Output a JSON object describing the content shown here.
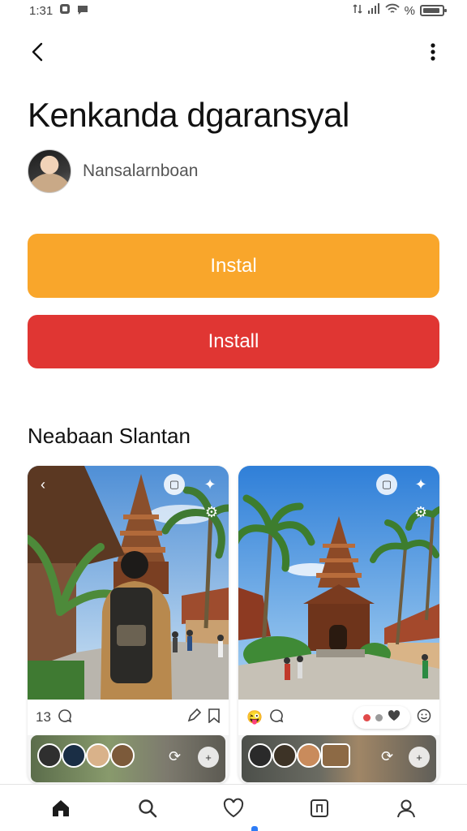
{
  "status_bar": {
    "time": "1:31",
    "right_text": "%"
  },
  "header": {
    "app_title": "Kenkanda dgaransyal",
    "developer_name": "Nansalarnboan"
  },
  "actions": {
    "primary_label": "Instal",
    "secondary_label": "Install"
  },
  "section": {
    "title": "Neabaan Slantan"
  },
  "cards": [
    {
      "count": "13"
    },
    {}
  ],
  "bottom_nav": {
    "items": [
      "home-icon",
      "search-icon",
      "heart-icon",
      "library-icon",
      "profile-icon"
    ],
    "active_index": 2
  },
  "colors": {
    "orange": "#f9a62b",
    "red": "#e03633",
    "accent": "#2d7cf6"
  }
}
